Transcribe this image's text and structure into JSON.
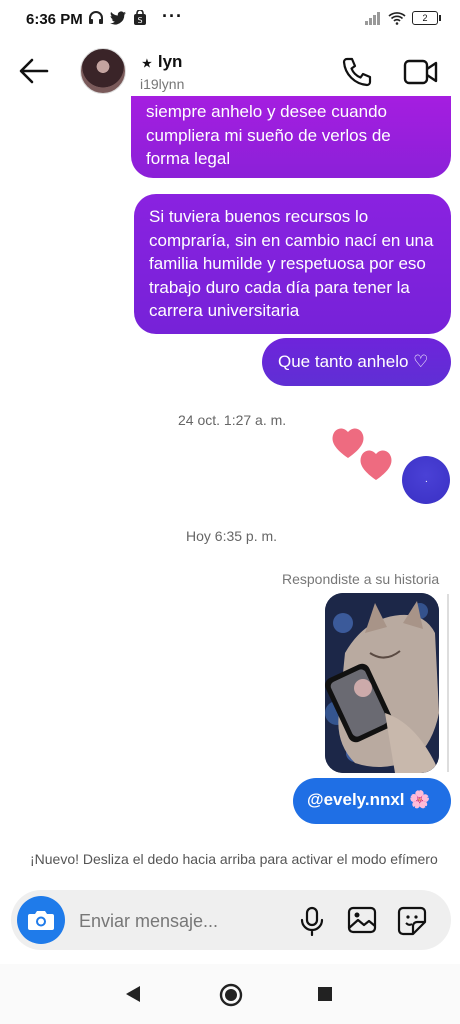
{
  "status_bar": {
    "time": "6:36 PM",
    "battery": "2"
  },
  "header": {
    "star": "★",
    "contact_name": "lyn",
    "username": "i19lynn"
  },
  "messages": [
    {
      "text": "siempre anhelo y desee cuando cumpliera mi sueño de verlos de forma legal"
    },
    {
      "text": "Si tuviera buenos recursos lo compraría, sin en cambio nací en una familia humilde y respetuosa por eso trabajo duro cada día para tener la carrera universitaria"
    },
    {
      "text": "Que tanto anhelo ♡"
    }
  ],
  "timestamps": {
    "first": "24 oct. 1:27 a. m.",
    "second": "Hoy 6:35 p. m."
  },
  "reaction_dot": ".",
  "story_reply": {
    "label": "Respondiste a su historia"
  },
  "mention": {
    "text": "@evely.nnxl 🌸"
  },
  "notice": "¡Nuevo! Desliza el dedo hacia arriba para activar el modo efímero",
  "composer": {
    "placeholder": "Enviar mensaje..."
  },
  "colors": {
    "accent_blue": "#1f6fe5",
    "bubble_purple": "#7622d8"
  }
}
